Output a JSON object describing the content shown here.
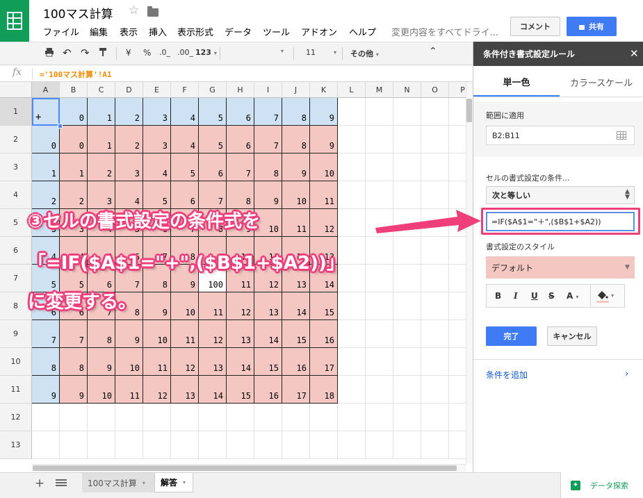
{
  "header": {
    "title": "100マス計算",
    "menus": [
      "ファイル",
      "編集",
      "表示",
      "挿入",
      "表示形式",
      "データ",
      "ツール",
      "アドオン",
      "ヘルプ"
    ],
    "changes_text": "変更内容をすべてドライ...",
    "comment_label": "コメント",
    "share_label": "共有"
  },
  "toolbar": {
    "currency": "¥",
    "percent": "%",
    "dec_less": ".0_",
    "dec_more": ".00_",
    "number_format": "123",
    "font_size": "11",
    "more": "その他"
  },
  "formula_bar": {
    "fx": "fx",
    "formula": "='100マス計算'!A1"
  },
  "grid": {
    "columns": [
      "A",
      "B",
      "C",
      "D",
      "E",
      "F",
      "G",
      "H",
      "I",
      "J",
      "K",
      "L",
      "M",
      "N",
      "O",
      "P"
    ],
    "rows": [
      "1",
      "2",
      "3",
      "4",
      "5",
      "6",
      "7",
      "8",
      "9",
      "10",
      "11",
      "12",
      "13"
    ],
    "selected_cell": "A1",
    "cells": [
      [
        "+",
        "0",
        "1",
        "2",
        "3",
        "4",
        "5",
        "6",
        "7",
        "8",
        "9"
      ],
      [
        "0",
        "0",
        "1",
        "2",
        "3",
        "4",
        "5",
        "6",
        "7",
        "8",
        "9"
      ],
      [
        "1",
        "1",
        "2",
        "3",
        "4",
        "5",
        "6",
        "7",
        "8",
        "9",
        "10"
      ],
      [
        "2",
        "2",
        "3",
        "4",
        "5",
        "6",
        "7",
        "8",
        "9",
        "10",
        "11"
      ],
      [
        "3",
        "3",
        "4",
        "5",
        "6",
        "7",
        "8",
        "9",
        "10",
        "11",
        "12"
      ],
      [
        "4",
        "4",
        "5",
        "6",
        "7",
        "8",
        "9",
        "10",
        "11",
        "12",
        "13"
      ],
      [
        "5",
        "5",
        "6",
        "7",
        "8",
        "9",
        "100",
        "11",
        "12",
        "13",
        "14"
      ],
      [
        "6",
        "6",
        "7",
        "8",
        "9",
        "10",
        "11",
        "12",
        "13",
        "14",
        "15"
      ],
      [
        "7",
        "7",
        "8",
        "9",
        "10",
        "11",
        "12",
        "13",
        "14",
        "15",
        "16"
      ],
      [
        "8",
        "8",
        "9",
        "10",
        "11",
        "12",
        "13",
        "14",
        "15",
        "16",
        "17"
      ],
      [
        "9",
        "9",
        "10",
        "11",
        "12",
        "13",
        "14",
        "15",
        "16",
        "17",
        "18"
      ]
    ]
  },
  "sheets": {
    "tabs": [
      "100マス計算",
      "解答"
    ],
    "active": "解答",
    "explore_label": "データ探索"
  },
  "panel": {
    "title": "条件付き書式設定ルール",
    "tab_single": "単一色",
    "tab_color_scale": "カラースケール",
    "range_label": "範囲に適用",
    "range_value": "B2:B11",
    "condition_label": "セルの書式設定の条件...",
    "condition_value": "次と等しい",
    "condition_formula": "=IF($A$1=\"＋\",($B$1+$A2))",
    "style_label": "書式設定のスタイル",
    "style_value": "デフォルト",
    "format_buttons": [
      "B",
      "I",
      "U",
      "S",
      "A"
    ],
    "done_label": "完了",
    "cancel_label": "キャンセル",
    "add_condition_label": "条件を追加"
  },
  "annotation": {
    "line1": "③セルの書式設定の条件式を",
    "line2": "「=IF($A$1=\"+\",($B$1+$A2))」",
    "line3": "に変更する。"
  },
  "colors": {
    "pink": "#f4c7c3",
    "blue": "#cfe2f3",
    "accent": "#ee3f7b",
    "primary": "#3e7bf5",
    "sheets_green": "#0f9d58"
  }
}
